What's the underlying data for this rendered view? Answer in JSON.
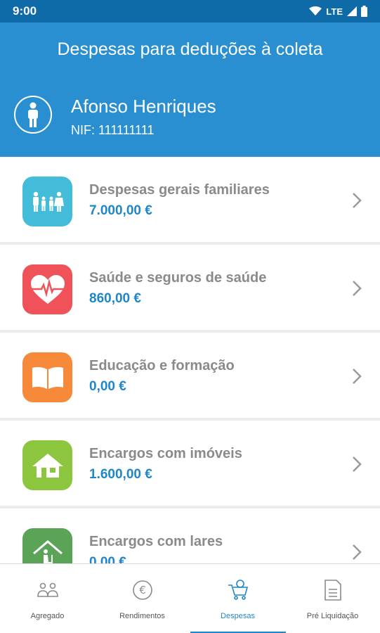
{
  "status_bar": {
    "time": "9:00",
    "network": "LTE"
  },
  "header": {
    "title": "Despesas para deduções à coleta"
  },
  "user": {
    "name": "Afonso Henriques",
    "nif": "NIF: 111111111"
  },
  "categories": [
    {
      "label": "Despesas gerais familiares",
      "amount": "7.000,00 €",
      "color": "#43bcd9",
      "icon": "family-icon"
    },
    {
      "label": "Saúde e seguros de saúde",
      "amount": "860,00 €",
      "color": "#f0525a",
      "icon": "heart-icon"
    },
    {
      "label": "Educação e formação",
      "amount": "0,00 €",
      "color": "#f7893a",
      "icon": "book-icon"
    },
    {
      "label": "Encargos com imóveis",
      "amount": "1.600,00 €",
      "color": "#8cc63f",
      "icon": "house-icon"
    },
    {
      "label": "Encargos com lares",
      "amount": "0,00 €",
      "color": "#5aa357",
      "icon": "care-home-icon"
    }
  ],
  "bottom_nav": {
    "items": [
      {
        "label": "Agregado",
        "icon": "household-icon"
      },
      {
        "label": "Rendimentos",
        "icon": "euro-icon"
      },
      {
        "label": "Despesas",
        "icon": "cart-icon"
      },
      {
        "label": "Pré Liquidação",
        "icon": "document-icon"
      }
    ],
    "active_index": 2
  },
  "colors": {
    "header": "#2a8fd0",
    "status_bar": "#0f6aa8",
    "accent": "#1f86c9"
  }
}
